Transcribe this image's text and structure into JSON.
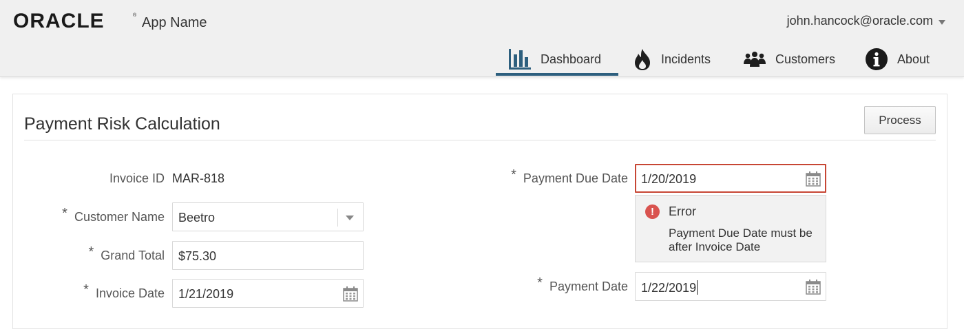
{
  "header": {
    "brand": "ORACLE",
    "app_name": "App Name",
    "user": "john.hancock@oracle.com"
  },
  "nav": {
    "items": [
      {
        "label": "Dashboard",
        "icon": "bar-chart-icon",
        "active": true
      },
      {
        "label": "Incidents",
        "icon": "fire-icon",
        "active": false
      },
      {
        "label": "Customers",
        "icon": "people-icon",
        "active": false
      },
      {
        "label": "About",
        "icon": "info-icon",
        "active": false
      }
    ],
    "active_color": "#2d5f7e"
  },
  "form": {
    "title": "Payment Risk Calculation",
    "process_label": "Process",
    "required_marker": "*",
    "invoice_id": {
      "label": "Invoice ID",
      "value": "MAR-818"
    },
    "customer_name": {
      "label": "Customer Name",
      "value": "Beetro",
      "icon": "chevron-down-icon"
    },
    "grand_total": {
      "label": "Grand Total",
      "value": "$75.30"
    },
    "invoice_date": {
      "label": "Invoice Date",
      "value": "1/21/2019",
      "icon": "calendar-icon"
    },
    "payment_due_date": {
      "label": "Payment Due Date",
      "value": "1/20/2019",
      "icon": "calendar-icon"
    },
    "payment_date": {
      "label": "Payment Date",
      "value": "1/22/2019",
      "icon": "calendar-icon"
    }
  },
  "error": {
    "title": "Error",
    "message": "Payment Due Date must be after Invoice Date",
    "icon": "error-icon",
    "color": "#c74634"
  }
}
